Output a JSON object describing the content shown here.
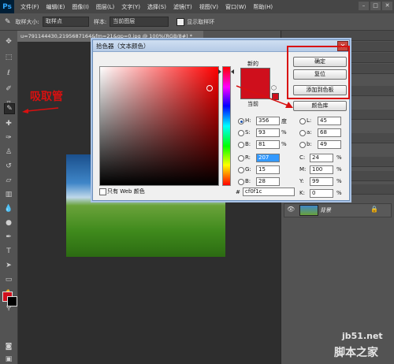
{
  "menu": {
    "logo": "Ps",
    "items": [
      "文件(F)",
      "编辑(E)",
      "图像(I)",
      "图层(L)",
      "文字(Y)",
      "选择(S)",
      "滤镜(T)",
      "视图(V)",
      "窗口(W)",
      "帮助(H)"
    ],
    "window_buttons": [
      "–",
      "□",
      "✕"
    ]
  },
  "options_bar": {
    "sample_size_label": "取样大小:",
    "sample_size_value": "取样点",
    "sample_label": "样本:",
    "sample_value": "当前图层",
    "show_ring_label": "显示取样环"
  },
  "document_tab": {
    "title": "u=791144430,2195687164&fm=21&gp=0.jpg @ 100%(RGB/8#) *"
  },
  "annotation": {
    "text": "吸取管",
    "color": "#d81010"
  },
  "dialog": {
    "title": "拾色器（文本颜色）",
    "new_label": "新的",
    "current_label": "当前",
    "current_color": "#cf0f1c",
    "buttons": {
      "ok": "确定",
      "reset": "复位",
      "add_swatch": "添加到色板",
      "libraries": "颜色库"
    },
    "hsb": [
      {
        "name": "H:",
        "value": "356",
        "unit": "度",
        "selected": true
      },
      {
        "name": "S:",
        "value": "93",
        "unit": "%",
        "selected": false
      },
      {
        "name": "B:",
        "value": "81",
        "unit": "%",
        "selected": false
      }
    ],
    "rgb": [
      {
        "name": "R:",
        "value": "207"
      },
      {
        "name": "G:",
        "value": "15"
      },
      {
        "name": "B:",
        "value": "28"
      }
    ],
    "lab": [
      {
        "name": "L:",
        "value": "45"
      },
      {
        "name": "a:",
        "value": "68"
      },
      {
        "name": "b:",
        "value": "49"
      }
    ],
    "cmyk": [
      {
        "name": "C:",
        "value": "24",
        "unit": "%"
      },
      {
        "name": "M:",
        "value": "100",
        "unit": "%"
      },
      {
        "name": "Y:",
        "value": "99",
        "unit": "%"
      },
      {
        "name": "K:",
        "value": "0",
        "unit": "%"
      }
    ],
    "hex_label": "#",
    "hex_value": "cf0f1c",
    "web_only_label": "只有 Web 颜色"
  },
  "layers": {
    "layer_name": "背景"
  },
  "watermark": {
    "line1": "jb51.net",
    "line2": "脚本之家"
  }
}
